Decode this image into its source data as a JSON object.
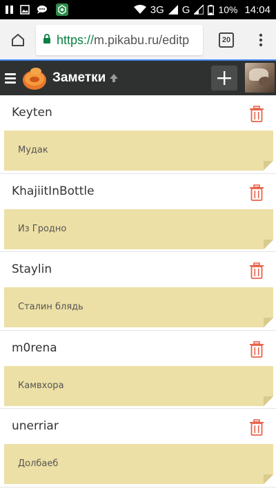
{
  "status_bar": {
    "network_1": "3G",
    "network_2": "G",
    "battery": "10%",
    "time": "14:04"
  },
  "browser": {
    "url_scheme": "https://",
    "url_rest": "m.pikabu.ru/editp",
    "tab_count": "20"
  },
  "app": {
    "title": "Заметки"
  },
  "notes": [
    {
      "name": "Keyten",
      "text": "Мудак"
    },
    {
      "name": "KhajiitInBottle",
      "text": "Из Гродно"
    },
    {
      "name": "Staylin",
      "text": "Сталин блядь"
    },
    {
      "name": "m0rena",
      "text": "Камвхора"
    },
    {
      "name": "unerriar",
      "text": "Долбаеб"
    }
  ],
  "colors": {
    "note_background": "#ede0a6",
    "header_background": "#2f3131",
    "trash_icon": "#e8624a",
    "url_secure": "#0b8043"
  }
}
